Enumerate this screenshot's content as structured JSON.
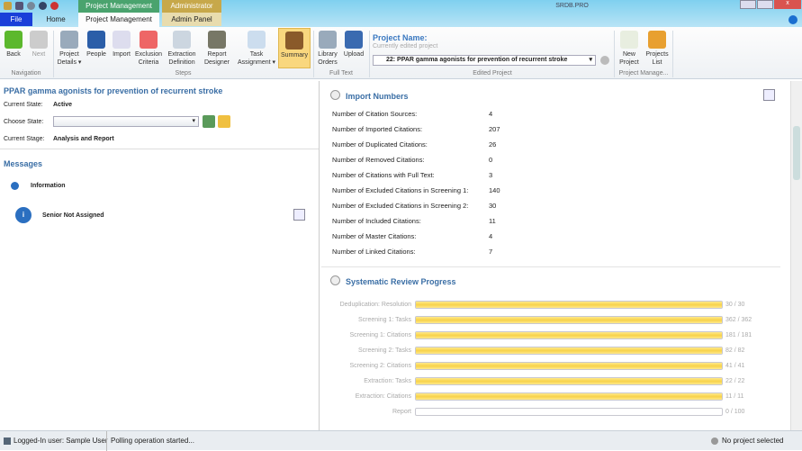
{
  "app": {
    "title": "SRDB.PRO"
  },
  "context_tabs": [
    {
      "label": "Project Management",
      "color": "#4aa36e"
    },
    {
      "label": "Administrator",
      "color": "#c7a84a"
    }
  ],
  "tabs": [
    {
      "label": "File"
    },
    {
      "label": "Home"
    },
    {
      "label": "Project Management"
    },
    {
      "label": "Admin Panel"
    }
  ],
  "ribbon": {
    "navigation": {
      "label": "Navigation",
      "items": [
        "Back",
        "Next"
      ]
    },
    "steps": {
      "label": "Steps",
      "items": [
        "Project Details ▾",
        "People",
        "Import",
        "Exclusion Criteria",
        "Extraction Definition",
        "Report Designer",
        "Task Assignment ▾",
        "Summary"
      ]
    },
    "full_text": {
      "label": "Full Text",
      "items": [
        "Library Orders",
        "Upload"
      ]
    },
    "edited_project": {
      "label": "Edited Project",
      "title": "Project Name:",
      "subtitle": "Currently edited project",
      "selected": "22: PPAR gamma agonists for prevention of recurrent stroke"
    },
    "project_manage": {
      "label": "Project Manage...",
      "items": [
        "New Project",
        "Projects List"
      ]
    }
  },
  "left": {
    "project_title": "PPAR gamma agonists for prevention of recurrent stroke",
    "current_state_label": "Current State:",
    "current_state": "Active",
    "choose_state_label": "Choose State:",
    "current_stage_label": "Current Stage:",
    "current_stage": "Analysis and Report",
    "messages_title": "Messages",
    "info_label": "Information",
    "message": "Senior Not Assigned"
  },
  "import_numbers": {
    "title": "Import Numbers",
    "rows": [
      {
        "label": "Number of Citation Sources:",
        "value": "4"
      },
      {
        "label": "Number of Imported Citations:",
        "value": "207"
      },
      {
        "label": "Number of Duplicated Citations:",
        "value": "26"
      },
      {
        "label": "Number of Removed Citations:",
        "value": "0"
      },
      {
        "label": "Number of Citations with Full Text:",
        "value": "3"
      },
      {
        "label": "Number of Excluded Citations in Screening 1:",
        "value": "140"
      },
      {
        "label": "Number of Excluded Citations in Screening 2:",
        "value": "30"
      },
      {
        "label": "Number of Included Citations:",
        "value": "11"
      },
      {
        "label": "Number of Master Citations:",
        "value": "4"
      },
      {
        "label": "Number of Linked Citations:",
        "value": "7"
      }
    ]
  },
  "progress": {
    "title": "Systematic Review Progress",
    "rows": [
      {
        "label": "Deduplication: Resolution",
        "done": 30,
        "total": 30,
        "text": "30 / 30"
      },
      {
        "label": "Screening 1: Tasks",
        "done": 362,
        "total": 362,
        "text": "362 / 362"
      },
      {
        "label": "Screening 1: Citations",
        "done": 181,
        "total": 181,
        "text": "181 / 181"
      },
      {
        "label": "Screening 2: Tasks",
        "done": 82,
        "total": 82,
        "text": "82 / 82"
      },
      {
        "label": "Screening 2: Citations",
        "done": 41,
        "total": 41,
        "text": "41 / 41"
      },
      {
        "label": "Extraction: Tasks",
        "done": 22,
        "total": 22,
        "text": "22 / 22"
      },
      {
        "label": "Extraction: Citations",
        "done": 11,
        "total": 11,
        "text": "11 / 11"
      },
      {
        "label": "Report",
        "done": 0,
        "total": 100,
        "text": "0 / 100"
      }
    ]
  },
  "status": {
    "user": "Logged-In user: Sample User",
    "polling": "Polling operation started...",
    "project": "No project selected"
  }
}
